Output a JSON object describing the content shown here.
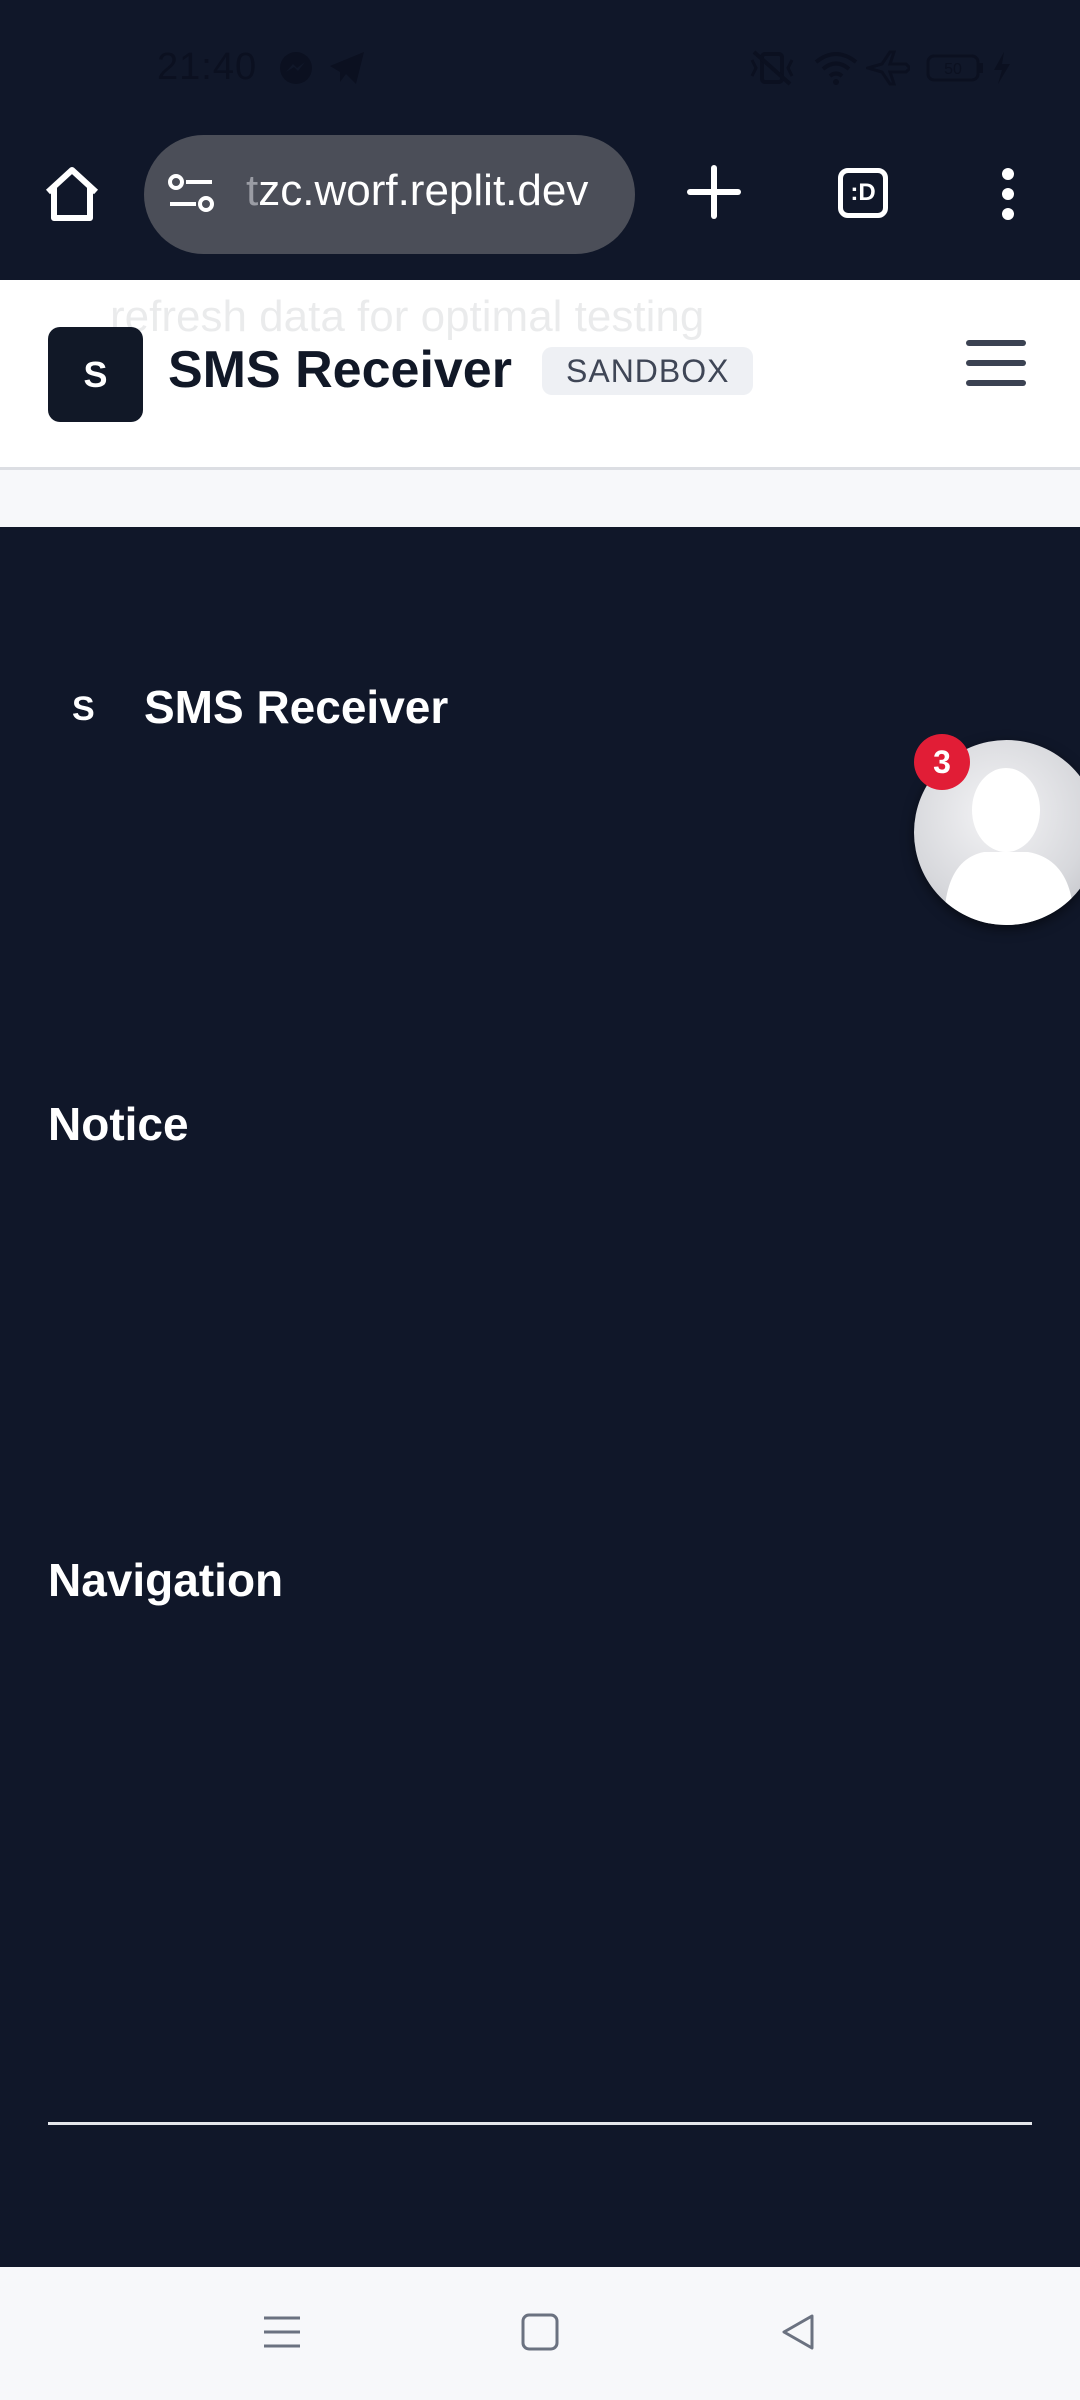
{
  "status_bar": {
    "time": "21:40",
    "battery_level": "50",
    "icons": [
      "messenger-icon",
      "telegram-icon",
      "vibrate-off-icon",
      "wifi-icon",
      "airplane-icon",
      "battery-icon",
      "charging-icon"
    ]
  },
  "browser": {
    "url_faded": "t",
    "url": "zc.worf.replit.dev",
    "tab_counter": ":D",
    "icons": [
      "home-icon",
      "site-settings-icon",
      "new-tab-icon",
      "tab-switcher-icon",
      "more-options-icon"
    ]
  },
  "header": {
    "logo_letter": "S",
    "title": "SMS Receiver",
    "badge": "SANDBOX",
    "ghost_text": "refresh data for optimal testing"
  },
  "sidebar": {
    "logo_letter": "S",
    "title": "SMS Receiver",
    "notice_heading": "Notice",
    "navigation_heading": "Navigation"
  },
  "chat_head": {
    "badge_count": "3"
  },
  "colors": {
    "dark_bg": "#101729",
    "header_bg": "#ffffff",
    "badge_red": "#e11d36"
  }
}
